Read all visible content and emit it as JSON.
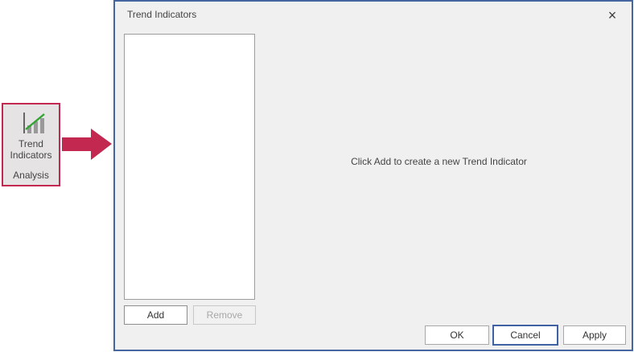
{
  "colors": {
    "accent_red": "#c22850",
    "dialog_border_blue": "#44659f",
    "focused_button_border": "#3f62a2",
    "dialog_background": "#f0f0f0",
    "ribbon_button_background": "#e5e3e3",
    "icon_bar_gray": "#999999",
    "icon_trend_green": "#33a333"
  },
  "ribbon_button": {
    "label_line1": "Trend",
    "label_line2": "Indicators",
    "group_label": "Analysis",
    "icon": "trend-bar-chart-icon"
  },
  "arrow": {
    "icon": "arrow-right-icon",
    "direction": "right"
  },
  "dialog": {
    "title": "Trend Indicators",
    "empty_message": "Click Add to create a new Trend Indicator",
    "list_items": [],
    "icons": {
      "close_glyph": "×"
    },
    "buttons": {
      "add": "Add",
      "remove": "Remove",
      "ok": "OK",
      "cancel": "Cancel",
      "apply": "Apply"
    }
  }
}
